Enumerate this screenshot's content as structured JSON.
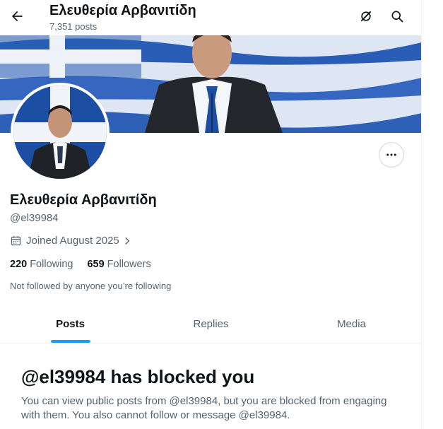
{
  "header": {
    "title": "Ελευθερία Αρβανιτίδη",
    "post_count": "7,351 posts",
    "back_icon": "arrow-left-icon",
    "grok_icon": "grok-icon",
    "search_icon": "search-icon"
  },
  "profile": {
    "display_name": "Ελευθερία Αρβανιτίδη",
    "handle": "@el39984",
    "joined": "Joined August 2025",
    "following_count": "220",
    "following_label": "Following",
    "followers_count": "659",
    "followers_label": "Followers",
    "not_followed_text": "Not followed by anyone you’re following"
  },
  "tabs": [
    {
      "label": "Posts",
      "active": true
    },
    {
      "label": "Replies",
      "active": false
    },
    {
      "label": "Media",
      "active": false
    }
  ],
  "blocked": {
    "title": "@el39984 has blocked you",
    "body": "You can view public posts from @el39984, but you are blocked from engaging with them. You also cannot follow or message @el39984."
  },
  "colors": {
    "accent": "#1d9bf0",
    "flag_blue": "#1c4fa3",
    "text_primary": "#0f1419",
    "text_secondary": "#536471"
  }
}
